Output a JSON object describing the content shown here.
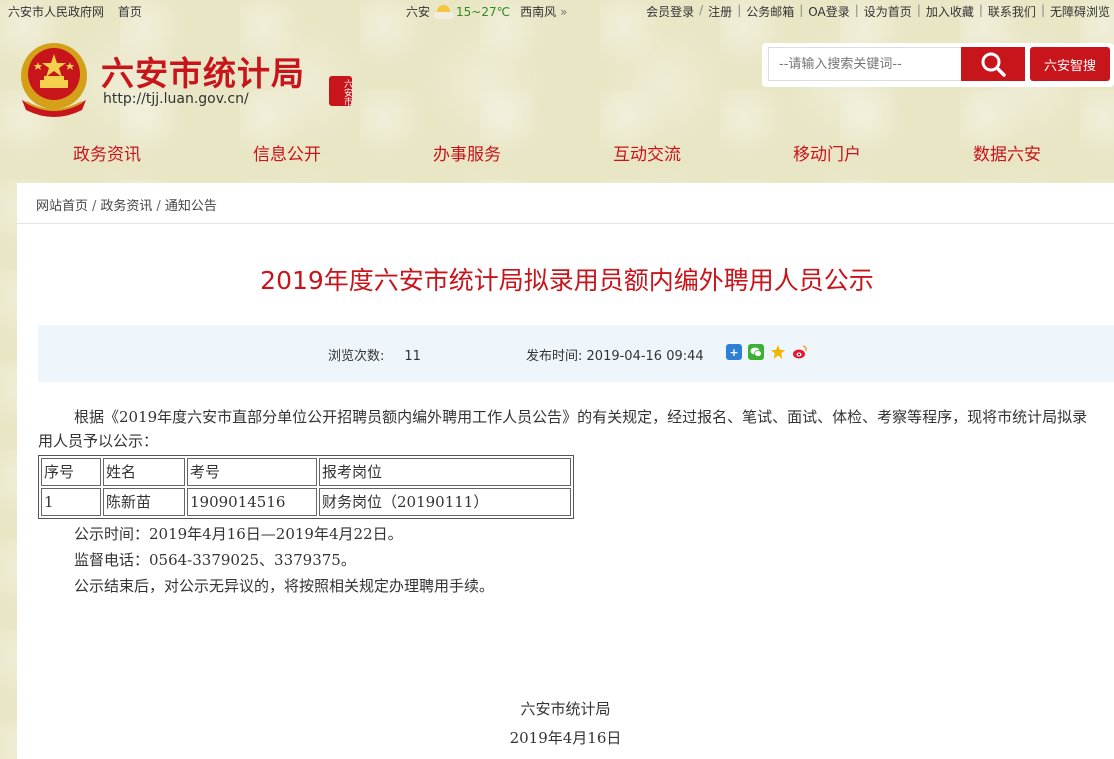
{
  "topbar": {
    "left_links": [
      "六安市人民政府网",
      "首页"
    ],
    "city": "六安",
    "temperature": "15~27℃",
    "wind": "西南风",
    "more": "»",
    "right_links": [
      "会员登录",
      "注册",
      "公务邮箱",
      "OA登录",
      "设为首页",
      "加入收藏",
      "联系我们",
      "无障碍浏览"
    ]
  },
  "header": {
    "title": "六安市统计局",
    "url": "http://tjj.luan.gov.cn/",
    "seal_text": "六安市"
  },
  "search": {
    "placeholder": "--请输入搜索关键词--",
    "smart_label": "六安智搜"
  },
  "nav": {
    "items": [
      "政务资讯",
      "信息公开",
      "办事服务",
      "互动交流",
      "移动门户",
      "数据六安"
    ]
  },
  "breadcrumb": [
    "网站首页",
    "政务资讯",
    "通知公告"
  ],
  "article": {
    "title": "2019年度六安市统计局拟录用员额内编外聘用人员公示",
    "views_label": "浏览次数:",
    "views": "11",
    "date_label": "发布时间:",
    "date": "2019-04-16 09:44",
    "intro": "根据《2019年度六安市直部分单位公开招聘员额内编外聘用工作人员公告》的有关规定，经过报名、笔试、面试、体检、考察等程序，现将市统计局拟录用人员予以公示：",
    "table": {
      "headers": [
        "序号",
        "姓名",
        "考号",
        "报考岗位"
      ],
      "rows": [
        [
          "1",
          "陈新苗",
          "1909014516",
          "财务岗位（20190111）"
        ]
      ]
    },
    "lines": [
      "公示时间：2019年4月16日—2019年4月22日。",
      "监督电话：0564-3379025、3379375。",
      "公示结束后，对公示无异议的，将按照相关规定办理聘用手续。"
    ],
    "signature": "六安市统计局",
    "sign_date": "2019年4月16日"
  },
  "colors": {
    "brand_red": "#c8141b",
    "background": "#e9e6c6",
    "meta_bg": "#eef5fb"
  }
}
